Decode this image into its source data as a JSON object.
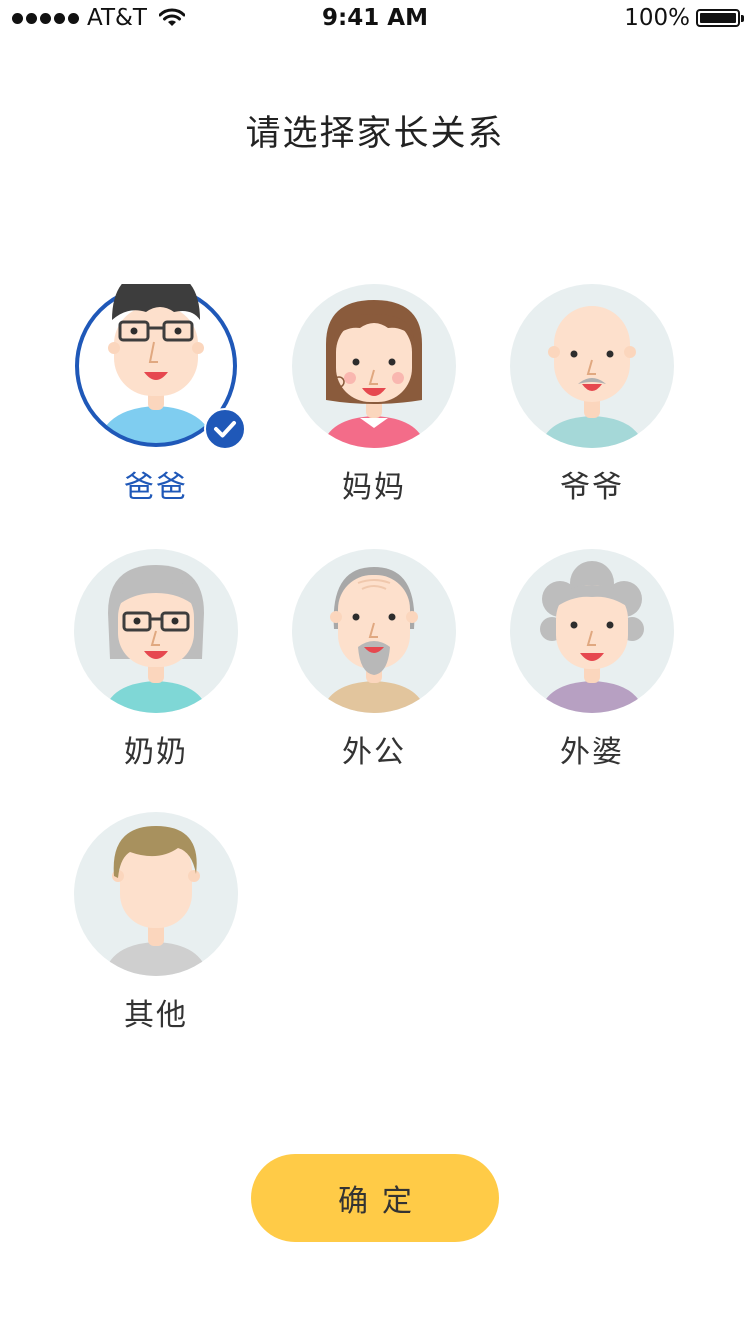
{
  "status_bar": {
    "carrier": "AT&T",
    "time": "9:41 AM",
    "battery": "100%",
    "icons": [
      "signal-dots-icon",
      "wifi-icon",
      "battery-icon"
    ]
  },
  "page": {
    "title": "请选择家长关系"
  },
  "relations": [
    {
      "label": "爸爸",
      "selected": true,
      "icon": "father-avatar-icon"
    },
    {
      "label": "妈妈",
      "selected": false,
      "icon": "mother-avatar-icon"
    },
    {
      "label": "爷爷",
      "selected": false,
      "icon": "grandfather-avatar-icon"
    },
    {
      "label": "奶奶",
      "selected": false,
      "icon": "grandmother-avatar-icon"
    },
    {
      "label": "外公",
      "selected": false,
      "icon": "maternal-grandfather-avatar-icon"
    },
    {
      "label": "外婆",
      "selected": false,
      "icon": "maternal-grandmother-avatar-icon"
    },
    {
      "label": "其他",
      "selected": false,
      "icon": "other-avatar-icon"
    }
  ],
  "confirm_button": {
    "label": "确定"
  },
  "colors": {
    "accent": "#1f58b8",
    "button": "#ffcb47",
    "avatar_bg": "#e8eff0",
    "skin": "#fde0cc"
  }
}
